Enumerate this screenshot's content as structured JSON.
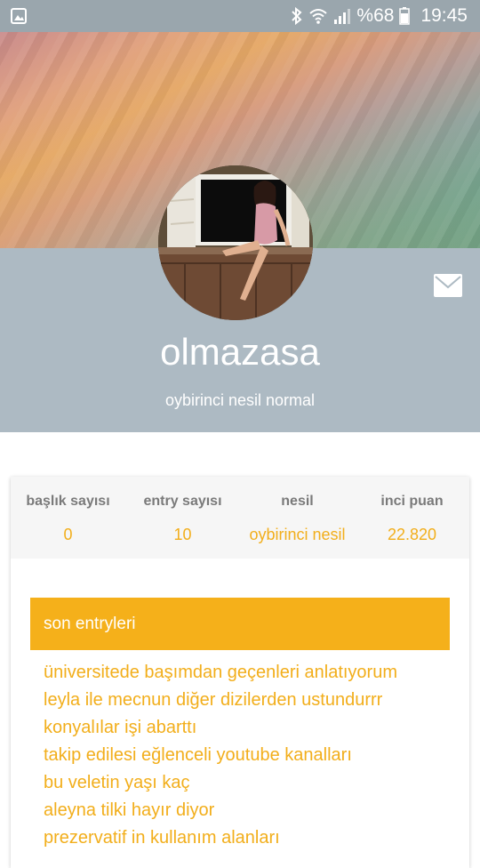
{
  "status_bar": {
    "battery_percent": "%68",
    "time": "19:45",
    "icons": [
      "gallery-icon",
      "bluetooth-icon",
      "wifi-icon",
      "signal-icon",
      "battery-icon"
    ]
  },
  "profile": {
    "username": "olmazasa",
    "generation_text": "oybirinci nesil normal",
    "avatar_icon": "user-photo"
  },
  "stats": {
    "columns": [
      {
        "label": "başlık sayısı",
        "value": "0"
      },
      {
        "label": "entry sayısı",
        "value": "10"
      },
      {
        "label": "nesil",
        "value": "oybirinci nesil"
      },
      {
        "label": "inci puan",
        "value": "22.820"
      }
    ]
  },
  "recent_entries": {
    "title": "son entryleri",
    "items": [
      "üniversitede başımdan geçenleri anlatıyorum",
      "leyla ile mecnun diğer dizilerden ustundurrr",
      "konyalılar işi abarttı",
      "takip edilesi eğlenceli youtube kanalları",
      "bu veletin yaşı kaç",
      "aleyna tilki hayır diyor",
      "prezervatif in kullanım alanları"
    ]
  },
  "colors": {
    "accent": "#f5b01a",
    "accent_text": "#f2ae1b",
    "panel": "#adbac3",
    "status_bar": "#9aa6ad"
  }
}
